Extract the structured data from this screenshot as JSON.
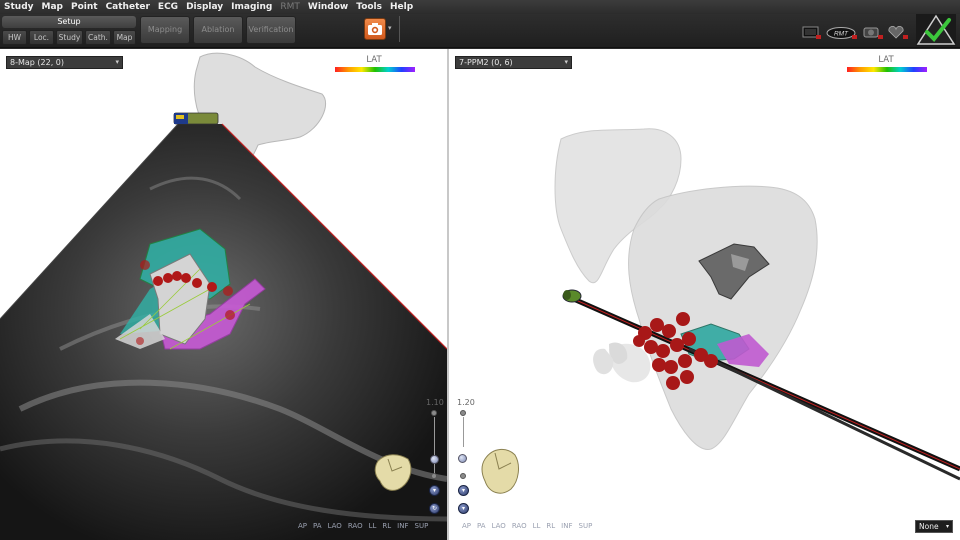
{
  "menu": [
    {
      "label": "Study",
      "enabled": true
    },
    {
      "label": "Map",
      "enabled": true
    },
    {
      "label": "Point",
      "enabled": true
    },
    {
      "label": "Catheter",
      "enabled": true
    },
    {
      "label": "ECG",
      "enabled": true
    },
    {
      "label": "Display",
      "enabled": true
    },
    {
      "label": "Imaging",
      "enabled": true
    },
    {
      "label": "RMT",
      "enabled": false
    },
    {
      "label": "Window",
      "enabled": true
    },
    {
      "label": "Tools",
      "enabled": true
    },
    {
      "label": "Help",
      "enabled": true
    }
  ],
  "toolbar": {
    "setup_label": "Setup",
    "setup_tabs": [
      "HW",
      "Loc.",
      "Study",
      "Cath.",
      "Map"
    ],
    "phases": [
      "Mapping",
      "Ablation",
      "Verification"
    ],
    "camera_icon": "camera-icon",
    "status_icons": [
      "monitor-status-icon",
      "rmt-status-icon",
      "catheter-status-icon",
      "heart-status-icon"
    ],
    "rmt_text": "RMT",
    "confirm_icon": "checkmark-triangle-icon"
  },
  "left_view": {
    "map_name": "8-Map (22, 0)",
    "lat_label": "LAT",
    "zoom": "1.10",
    "views": [
      "AP",
      "PA",
      "LAO",
      "RAO",
      "LL",
      "RL",
      "INF",
      "SUP"
    ]
  },
  "right_view": {
    "map_name": "7-PPM2 (0, 6)",
    "lat_label": "LAT",
    "zoom": "1.20",
    "views": [
      "AP",
      "PA",
      "LAO",
      "RAO",
      "LL",
      "RL",
      "INF",
      "SUP"
    ],
    "bottom_select": "None"
  },
  "colors": {
    "lat_scale": [
      "#ff2020",
      "#ff9a00",
      "#ffe800",
      "#20c000",
      "#00d0d0",
      "#2040ff",
      "#a020ff"
    ],
    "ablation_point": "#b01818",
    "camera_button": "#e06a2a",
    "confirm_check": "#3cc63c"
  }
}
